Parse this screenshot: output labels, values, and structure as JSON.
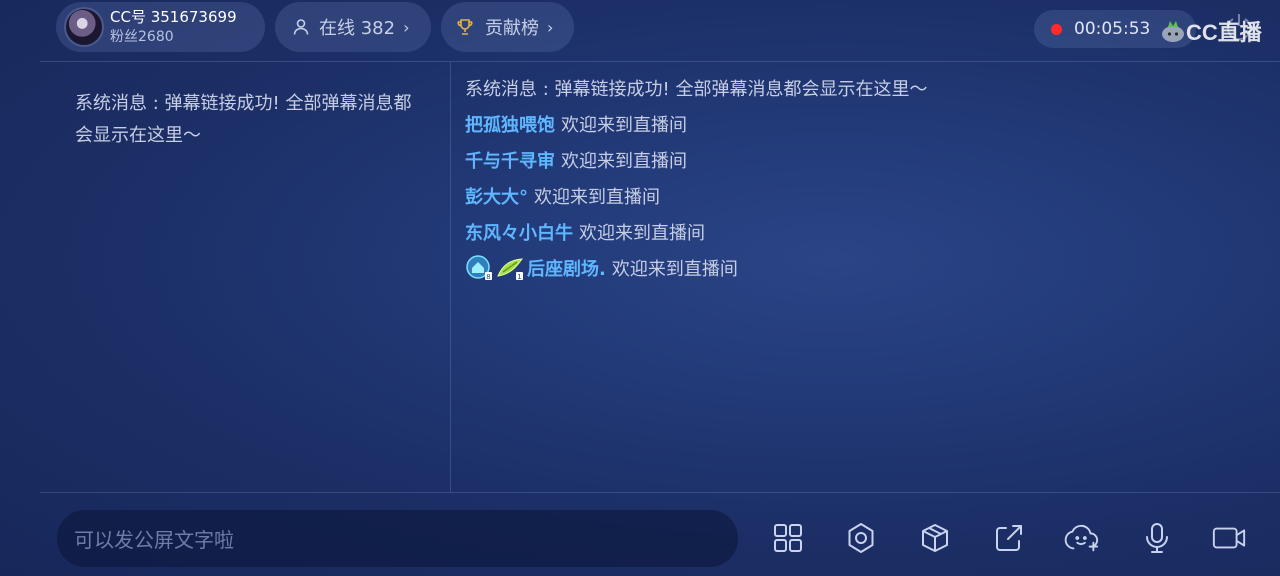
{
  "header": {
    "cc_id": "CC号 351673699",
    "fans": "粉丝2680",
    "online": "在线 382",
    "contribution": "贡献榜",
    "timer": "00:05:53",
    "logo": "CC直播"
  },
  "left_panel": {
    "system_message": "系统消息 : 弹幕链接成功! 全部弹幕消息都会显示在这里～"
  },
  "chat": {
    "system_message": "系统消息 : 弹幕链接成功! 全部弹幕消息都会显示在这里～",
    "messages": [
      {
        "user": "把孤独喂饱",
        "text": "欢迎来到直播间"
      },
      {
        "user": "千与千寻审",
        "text": "欢迎来到直播间"
      },
      {
        "user": "彭大大°",
        "text": "欢迎来到直播间"
      },
      {
        "user": "东风々小白牛",
        "text": "欢迎来到直播间"
      },
      {
        "user": "后座剧场.",
        "text": "欢迎来到直播间"
      }
    ]
  },
  "bottom": {
    "input_placeholder": "可以发公屏文字啦"
  },
  "icons": {
    "user": "user-icon",
    "trophy": "trophy-icon",
    "record": "record-dot-icon",
    "power": "power-icon",
    "apps": "apps-grid-icon",
    "settings": "settings-gear-icon",
    "box": "box-icon",
    "share": "share-icon",
    "emoji": "emoji-add-icon",
    "mic": "microphone-icon",
    "camera": "video-camera-icon"
  },
  "colors": {
    "username": "#5fb6ff",
    "record": "#ff2a2a"
  }
}
